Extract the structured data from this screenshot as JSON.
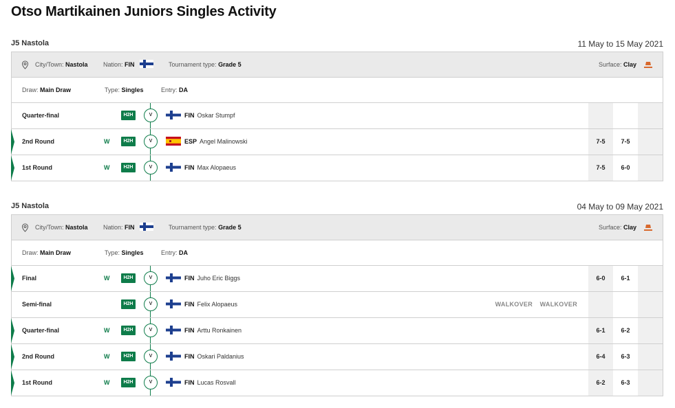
{
  "title": "Otso Martikainen Juniors Singles Activity",
  "colors": {
    "accent": "#0e7c4a",
    "info_bg": "#eaeaea",
    "clay": "#d8692d"
  },
  "tournaments": [
    {
      "name": "J5 Nastola",
      "dates": "11 May to 15 May 2021",
      "city_label": "City/Town:",
      "city": "Nastola",
      "nation_label": "Nation:",
      "nation": "FIN",
      "ttype_label": "Tournament type:",
      "ttype": "Grade 5",
      "surface_label": "Surface:",
      "surface": "Clay",
      "draw_label": "Draw:",
      "draw": "Main Draw",
      "type_label": "Type:",
      "type": "Singles",
      "entry_label": "Entry:",
      "entry": "DA",
      "matches": [
        {
          "round": "Quarter-final",
          "result": "",
          "h2h": "H2H",
          "vs": "V",
          "flag": "finland-flag",
          "nation": "FIN",
          "opponent": "Oskar Stumpf",
          "s1": "",
          "s2": ""
        },
        {
          "round": "2nd Round",
          "result": "W",
          "h2h": "H2H",
          "vs": "V",
          "flag": "spain-flag",
          "nation": "ESP",
          "opponent": "Angel Malinowski",
          "s1": "7-5",
          "s2": "7-5"
        },
        {
          "round": "1st Round",
          "result": "W",
          "h2h": "H2H",
          "vs": "V",
          "flag": "finland-flag",
          "nation": "FIN",
          "opponent": "Max Alopaeus",
          "s1": "7-5",
          "s2": "6-0"
        }
      ]
    },
    {
      "name": "J5 Nastola",
      "dates": "04 May to 09 May 2021",
      "city_label": "City/Town:",
      "city": "Nastola",
      "nation_label": "Nation:",
      "nation": "FIN",
      "ttype_label": "Tournament type:",
      "ttype": "Grade 5",
      "surface_label": "Surface:",
      "surface": "Clay",
      "draw_label": "Draw:",
      "draw": "Main Draw",
      "type_label": "Type:",
      "type": "Singles",
      "entry_label": "Entry:",
      "entry": "DA",
      "matches": [
        {
          "round": "Final",
          "result": "W",
          "h2h": "H2H",
          "vs": "V",
          "flag": "finland-flag",
          "nation": "FIN",
          "opponent": "Juho Eric Biggs",
          "s1": "6-0",
          "s2": "6-1"
        },
        {
          "round": "Semi-final",
          "result": "",
          "h2h": "H2H",
          "vs": "V",
          "flag": "finland-flag",
          "nation": "FIN",
          "opponent": "Felix Alopaeus",
          "s1": "",
          "s2": "",
          "walkover1": "WALKOVER",
          "walkover2": "WALKOVER"
        },
        {
          "round": "Quarter-final",
          "result": "W",
          "h2h": "H2H",
          "vs": "V",
          "flag": "finland-flag",
          "nation": "FIN",
          "opponent": "Arttu Ronkainen",
          "s1": "6-1",
          "s2": "6-2"
        },
        {
          "round": "2nd Round",
          "result": "W",
          "h2h": "H2H",
          "vs": "V",
          "flag": "finland-flag",
          "nation": "FIN",
          "opponent": "Oskari Paldanius",
          "s1": "6-4",
          "s2": "6-3"
        },
        {
          "round": "1st Round",
          "result": "W",
          "h2h": "H2H",
          "vs": "V",
          "flag": "finland-flag",
          "nation": "FIN",
          "opponent": "Lucas Rosvall",
          "s1": "6-2",
          "s2": "6-3"
        }
      ]
    }
  ]
}
